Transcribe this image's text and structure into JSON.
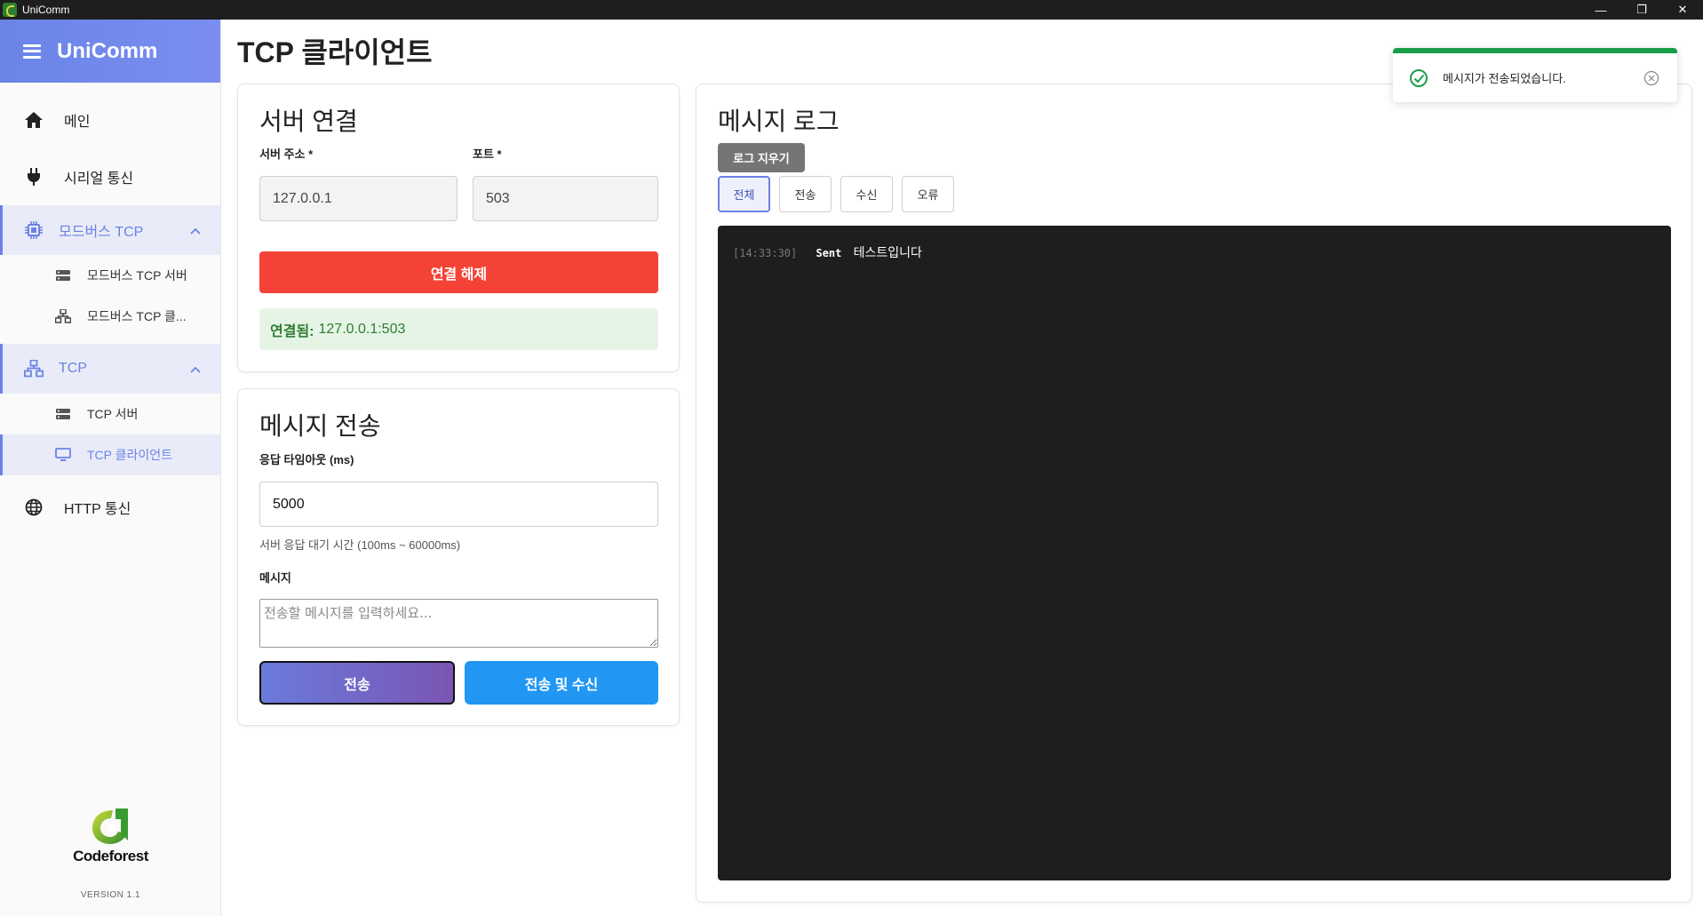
{
  "window": {
    "title": "UniComm",
    "minimize": "—",
    "restore": "❐",
    "close": "✕"
  },
  "sidebar": {
    "brand": "UniComm",
    "items": [
      {
        "label": "메인"
      },
      {
        "label": "시리얼 통신"
      }
    ],
    "groups": [
      {
        "label": "모드버스 TCP",
        "children": [
          {
            "label": "모드버스 TCP 서버"
          },
          {
            "label": "모드버스 TCP 클..."
          }
        ]
      },
      {
        "label": "TCP",
        "children": [
          {
            "label": "TCP 서버"
          },
          {
            "label": "TCP 클라이언트"
          }
        ]
      }
    ],
    "http": {
      "label": "HTTP 통신"
    },
    "logo_text": "Codeforest",
    "version": "VERSION 1.1"
  },
  "page": {
    "title": "TCP 클라이언트"
  },
  "connection": {
    "title": "서버 연결",
    "address_label": "서버 주소 *",
    "address_value": "127.0.0.1",
    "port_label": "포트 *",
    "port_value": "503",
    "disconnect_label": "연결 해제",
    "status_key": "연결됨:",
    "status_value": "127.0.0.1:503"
  },
  "send": {
    "title": "메시지 전송",
    "timeout_label": "응답 타임아웃 (ms)",
    "timeout_value": "5000",
    "timeout_helper": "서버 응답 대기 시간 (100ms ~ 60000ms)",
    "message_label": "메시지",
    "message_placeholder": "전송할 메시지를 입력하세요...",
    "send_label": "전송",
    "send_receive_label": "전송 및 수신"
  },
  "log": {
    "title": "메시지 로그",
    "clear_label": "로그 지우기",
    "filters": [
      "전체",
      "전송",
      "수신",
      "오류"
    ],
    "active_filter": "전체",
    "entries": [
      {
        "time": "[14:33:30]",
        "direction": "Sent",
        "text": "테스트입니다"
      }
    ]
  },
  "toast": {
    "message": "메시지가 전송되었습니다.",
    "status_color": "#1b9e4b"
  },
  "colors": {
    "accent": "#6b82e6",
    "danger": "#f44336",
    "info": "#2196f3",
    "log_bg": "#1e1e1e"
  }
}
